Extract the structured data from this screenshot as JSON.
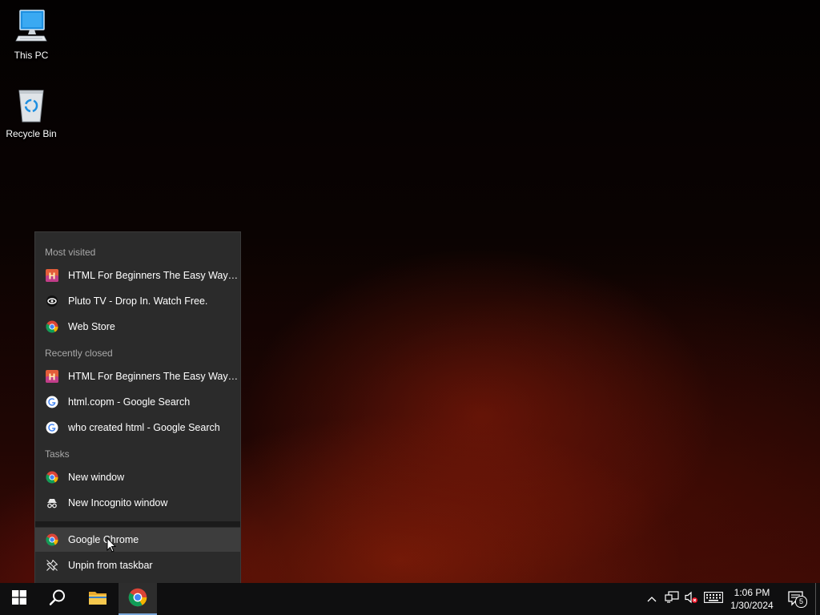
{
  "desktop": {
    "icons": [
      {
        "label": "This PC",
        "icon": "this-pc-icon"
      },
      {
        "label": "Recycle Bin",
        "icon": "recycle-bin-icon"
      }
    ]
  },
  "jumplist": {
    "most_visited": {
      "header": "Most visited",
      "items": [
        {
          "label": "HTML For Beginners The Easy Way: Sta...",
          "icon": "html-favicon-icon"
        },
        {
          "label": "Pluto TV - Drop In. Watch Free.",
          "icon": "pluto-tv-icon"
        },
        {
          "label": "Web Store",
          "icon": "chrome-icon"
        }
      ]
    },
    "recently_closed": {
      "header": "Recently closed",
      "items": [
        {
          "label": "HTML For Beginners The Easy Way: Sta...",
          "icon": "html-favicon-icon"
        },
        {
          "label": "html.copm - Google Search",
          "icon": "google-icon"
        },
        {
          "label": "who created html - Google Search",
          "icon": "google-icon"
        }
      ]
    },
    "tasks": {
      "header": "Tasks",
      "items": [
        {
          "label": "New window",
          "icon": "chrome-icon"
        },
        {
          "label": "New Incognito window",
          "icon": "incognito-icon"
        }
      ]
    },
    "app": {
      "label": "Google Chrome",
      "icon": "chrome-icon"
    },
    "unpin": {
      "label": "Unpin from taskbar",
      "icon": "unpin-icon"
    }
  },
  "taskbar": {
    "buttons": [
      {
        "name": "start",
        "icon": "windows-logo-icon"
      },
      {
        "name": "search",
        "icon": "search-icon"
      },
      {
        "name": "file-explorer",
        "icon": "folder-icon"
      },
      {
        "name": "google-chrome",
        "icon": "chrome-icon",
        "active": true
      }
    ],
    "tray": {
      "time": "1:06 PM",
      "date": "1/30/2024",
      "notification_count": "5"
    }
  },
  "colors": {
    "jumplist_bg": "#2b2b2b",
    "taskbar_bg": "#0f0f10",
    "active_indicator": "#7aa7d9",
    "section_header": "#a8a8a8"
  }
}
